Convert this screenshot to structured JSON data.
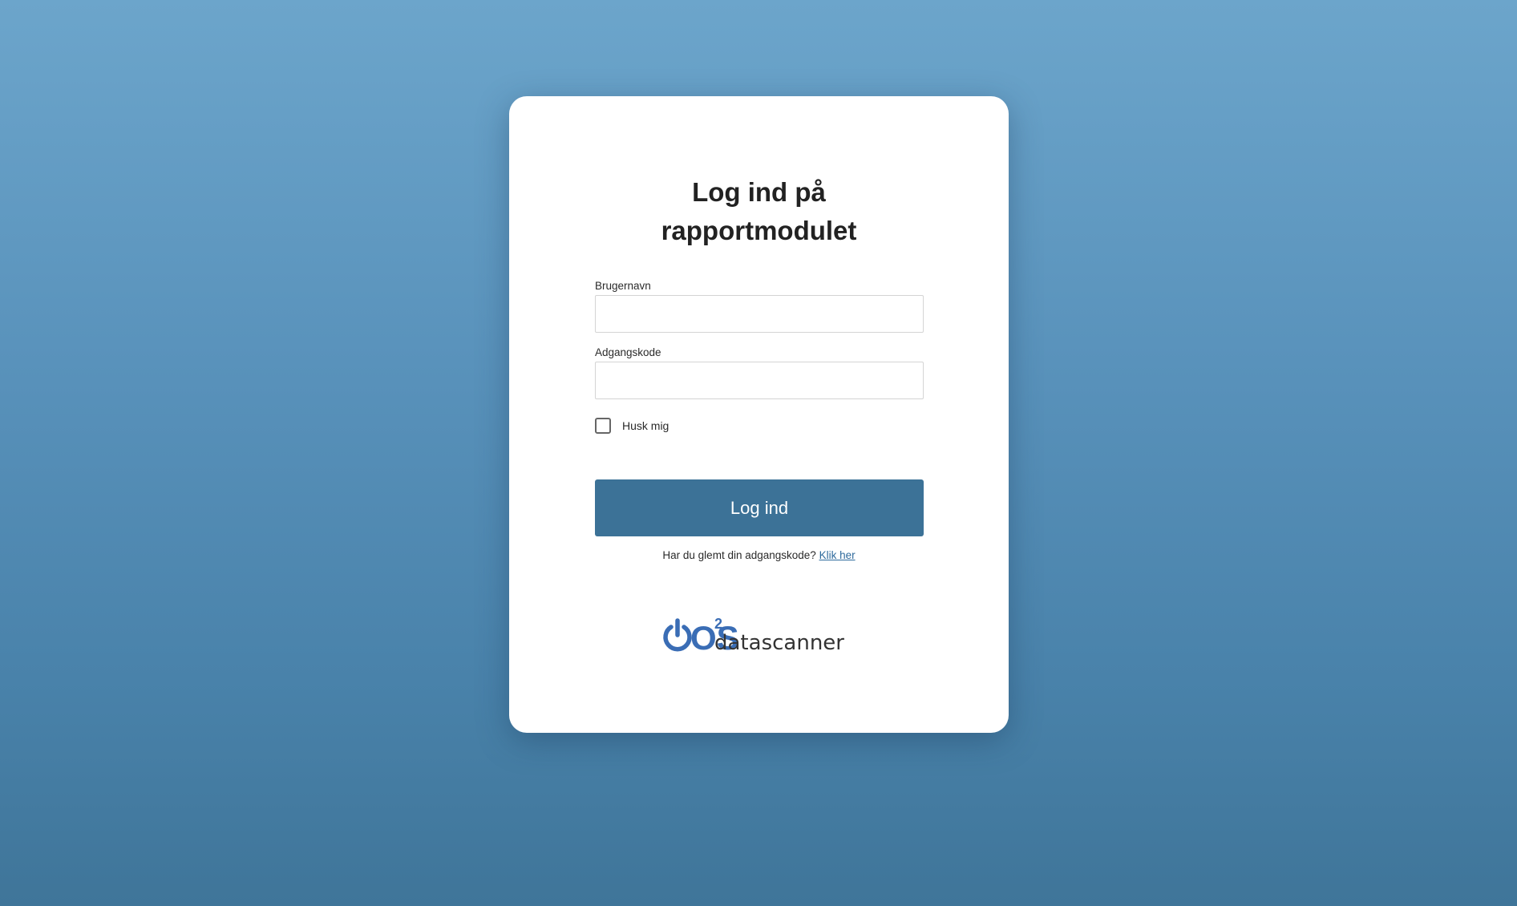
{
  "login": {
    "title_line1": "Log ind på",
    "title_line2": "rapportmodulet",
    "username_label": "Brugernavn",
    "username_value": "",
    "password_label": "Adgangskode",
    "password_value": "",
    "remember_label": "Husk mig",
    "remember_checked": false,
    "submit_label": "Log ind",
    "forgot_text": "Har du glemt din adgangskode?",
    "forgot_link": "Klik her"
  },
  "logo": {
    "brand": "OS",
    "superscript": "2",
    "product": "datascanner",
    "color": "#3a6db5"
  },
  "colors": {
    "button": "#3c7297",
    "background_top": "#6ca5cb",
    "background_bottom": "#3f7599"
  }
}
